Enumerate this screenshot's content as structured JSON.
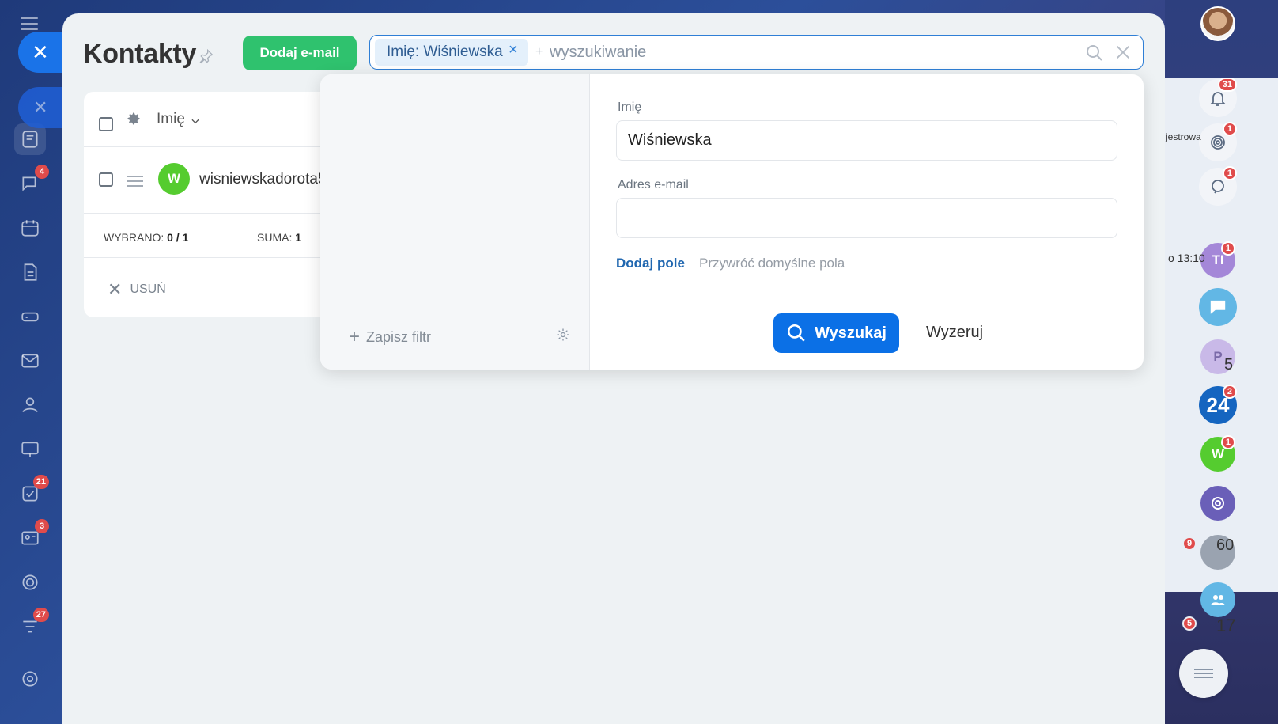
{
  "page": {
    "title": "Kontakty",
    "add_email_label": "Dodaj e-mail"
  },
  "search": {
    "chip_label": "Imię: Wiśniewska",
    "chip_close": "×",
    "plus": "+",
    "placeholder": "wyszukiwanie"
  },
  "grid": {
    "column_header": "Imię",
    "rows": [
      {
        "avatar_letter": "W",
        "name": "wisniewskadorota5",
        "avatar_color": "#55cc2f"
      }
    ],
    "footer": {
      "selected_label": "WYBRANO:",
      "selected_value": "0 / 1",
      "sum_label": "SUMA:",
      "sum_value": "1"
    },
    "delete_label": "USUŃ"
  },
  "filter": {
    "save_filter_label": "Zapisz filtr",
    "fields": [
      {
        "label": "Imię",
        "value": "Wiśniewska"
      },
      {
        "label": "Adres e-mail",
        "value": ""
      }
    ],
    "add_field_label": "Dodaj pole",
    "restore_fields_label": "Przywróć domyślne pola",
    "search_button_label": "Wyszukaj",
    "reset_button_label": "Wyzeruj"
  },
  "left_sidebar": {
    "badges": {
      "messenger": "4",
      "tasks": "21",
      "crm": "3",
      "funnel": "27"
    },
    "top_badge": "4"
  },
  "right_sidebar": {
    "notifications_badge": "31",
    "target_badge": "1",
    "chat_search_badge": "1",
    "avatar_ti_label": "TI",
    "avatar_ti_badge": "1",
    "avatar_p_label": "P",
    "b24_label": "24",
    "b24_badge": "2",
    "avatar_w_label": "W",
    "avatar_w_badge": "1",
    "left_badge_9": "9",
    "left_badge_5": "5",
    "peek_text_1": "jestrowa",
    "peek_text_2": "o 13:10",
    "peek_num_5": "5",
    "peek_num_60": "60",
    "peek_num_17": "17"
  },
  "colors": {
    "accent": "#0b70e6",
    "add_button": "#2fc26e",
    "badge": "#e04b4b",
    "avatar_green": "#55cc2f",
    "b24_blue": "#1565c0"
  }
}
